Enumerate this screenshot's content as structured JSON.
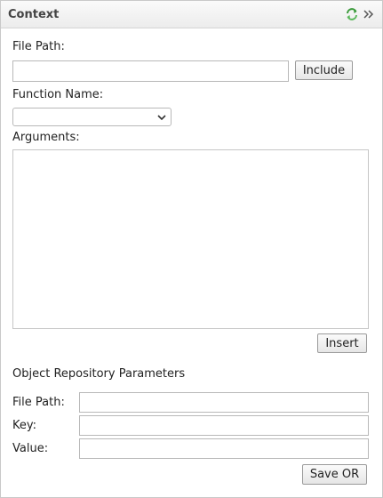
{
  "panel": {
    "title": "Context",
    "icons": {
      "refresh": "refresh-icon",
      "collapse": "double-chevron-right-icon"
    }
  },
  "include": {
    "file_path_label": "File Path:",
    "file_path_value": "",
    "include_button": "Include"
  },
  "function": {
    "label": "Function Name:",
    "selected": ""
  },
  "arguments": {
    "label": "Arguments:",
    "value": "",
    "insert_button": "Insert"
  },
  "object_repository": {
    "heading": "Object Repository Parameters",
    "file_path_label": "File Path:",
    "file_path_value": "",
    "key_label": "Key:",
    "key_value": "",
    "value_label": "Value:",
    "value_value": "",
    "save_button": "Save OR"
  },
  "colors": {
    "refresh_green": "#3a9a3a",
    "border": "#b8b8b8"
  }
}
